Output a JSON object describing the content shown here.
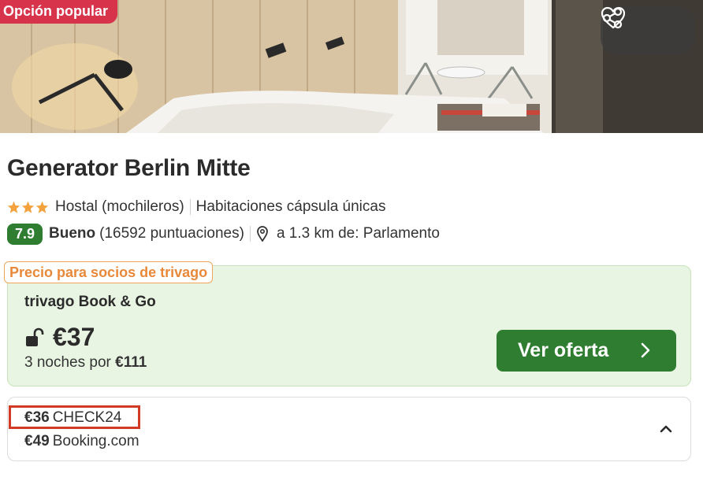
{
  "hero": {
    "badge": "Opción popular",
    "share_icon": "share-icon",
    "favorite_icon": "heart-icon"
  },
  "hotel": {
    "name": "Generator Berlin Mitte",
    "stars": 3,
    "type": "Hostal (mochileros)",
    "feature": "Habitaciones cápsula únicas",
    "rating": "7.9",
    "rating_label": "Bueno",
    "reviews": "(16592 puntuaciones)",
    "distance": "a 1.3 km de: Parlamento"
  },
  "offer": {
    "partner_tag": "Precio para socios de trivago",
    "provider": "trivago Book & Go",
    "price": "€37",
    "nights_text": "3 noches por",
    "nights_total": "€111",
    "button_label": "Ver oferta"
  },
  "other_offers": [
    {
      "price": "€36",
      "provider": "CHECK24"
    },
    {
      "price": "€49",
      "provider": "Booking.com"
    }
  ],
  "colors": {
    "accent_green": "#2f7d31",
    "badge_red": "#d7344c",
    "partner_orange": "#e8893a",
    "highlight_red": "#d23a25"
  }
}
